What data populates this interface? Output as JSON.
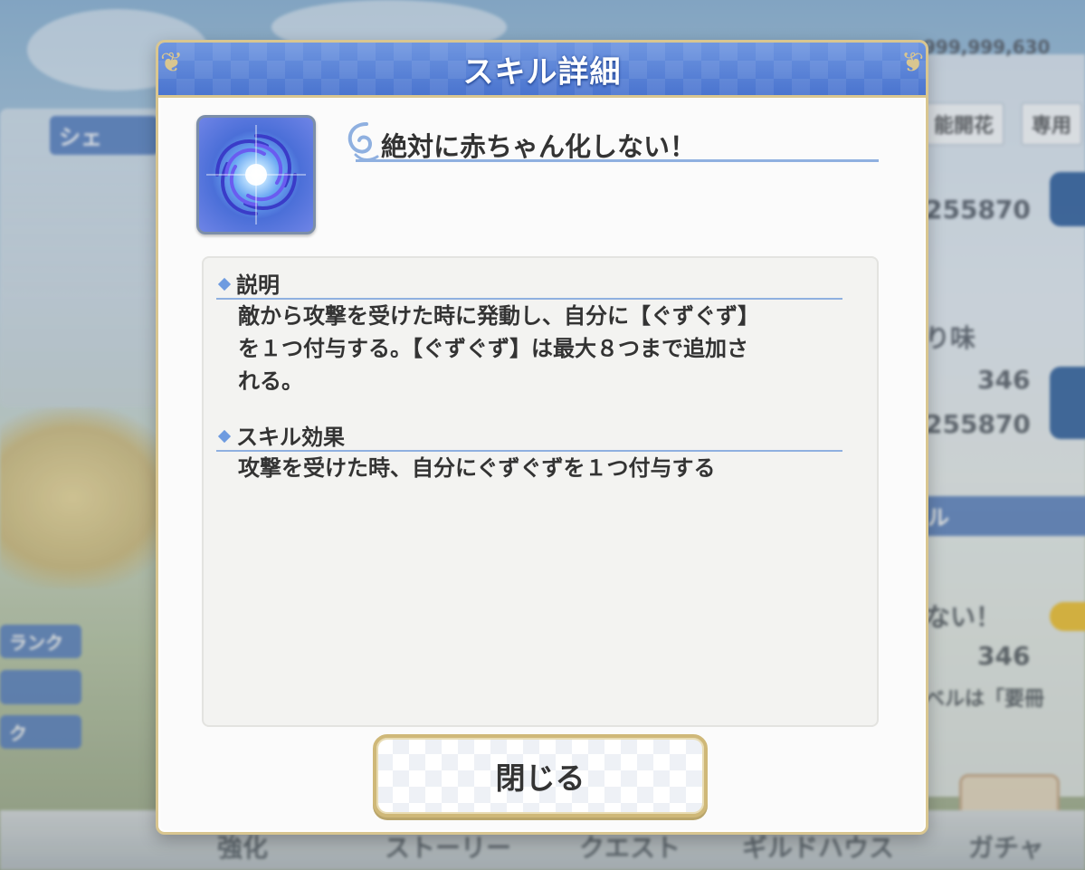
{
  "dialog": {
    "title": "スキル詳細",
    "skill_icon": "vortex-skill-icon",
    "skill_name": "絶対に赤ちゃん化しない！",
    "description_heading": "説明",
    "description_lines": [
      "敵から攻撃を受けた時に発動し、自分に【ぐずぐず】",
      "を１つ付与する。【ぐずぐず】は最大８つまで追加さ",
      "れる。"
    ],
    "effect_heading": "スキル効果",
    "effect_text": "攻撃を受けた時、自分にぐずぐずを１つ付与する",
    "close_label": "閉じる"
  },
  "background": {
    "currency": "999,999,630",
    "tabs": [
      "能開花",
      "専用"
    ],
    "stat_a": "255870",
    "stat_label": "り味",
    "stat_b": "346",
    "stat_c": "255870",
    "section_label": "ル",
    "skill_fragment": "ない！",
    "stat_d": "346",
    "level_note": "ベルは「要冊",
    "side_labels": [
      "ランク",
      "ク"
    ],
    "nav": [
      "強化",
      "ストーリー",
      "クエスト",
      "ギルドハウス",
      "ガチャ"
    ],
    "side_name": "シェ"
  },
  "colors": {
    "header_blue": "#4a74cf",
    "gold_border": "#d9c690",
    "accent_line": "#8fb0e0",
    "text": "#333333"
  }
}
